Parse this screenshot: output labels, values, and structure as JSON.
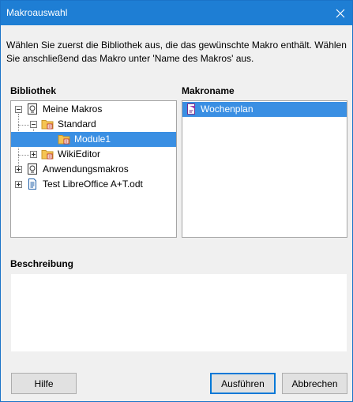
{
  "window": {
    "title": "Makroauswahl"
  },
  "intro": {
    "text": "Wählen Sie zuerst die Bibliothek aus, die das gewünschte Makro enthält. Wählen Sie anschließend das Makro unter 'Name des Makros' aus."
  },
  "library": {
    "label": "Bibliothek",
    "items": [
      {
        "label": "Meine Makros",
        "icon": "library-icon",
        "expanded": true
      },
      {
        "label": "Standard",
        "icon": "folder-icon",
        "expanded": true
      },
      {
        "label": "Module1",
        "icon": "module-folder-icon",
        "selected": true
      },
      {
        "label": "WikiEditor",
        "icon": "folder-icon",
        "expanded": false
      },
      {
        "label": "Anwendungsmakros",
        "icon": "library-icon",
        "expanded": false
      },
      {
        "label": "Test LibreOffice A+T.odt",
        "icon": "document-icon",
        "expanded": false
      }
    ]
  },
  "macro_name": {
    "label": "Makroname",
    "items": [
      {
        "label": "Wochenplan",
        "icon": "macro-icon",
        "selected": true
      }
    ]
  },
  "description": {
    "label": "Beschreibung",
    "text": ""
  },
  "buttons": {
    "help": "Hilfe",
    "run": "Ausführen",
    "cancel": "Abbrechen"
  },
  "colors": {
    "titlebar": "#1e7ed4",
    "selection": "#3a8fe3",
    "default_button_border": "#0078d7"
  }
}
